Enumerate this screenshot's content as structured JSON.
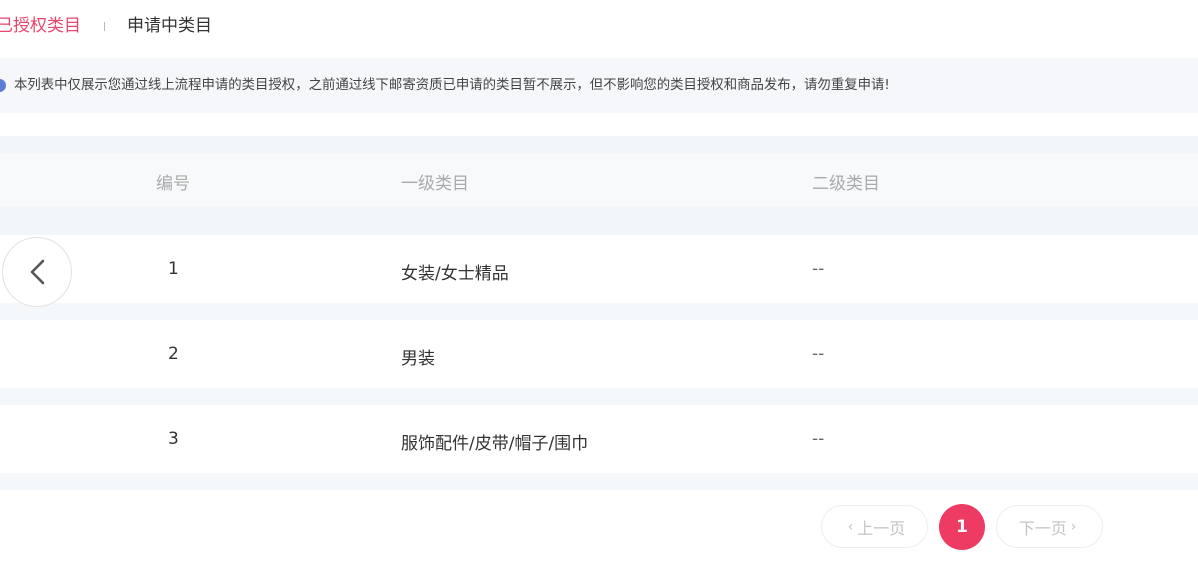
{
  "tabs": {
    "authorized": "已授权类目",
    "applying": "申请中类目"
  },
  "notice": {
    "text": "本列表中仅展示您通过线上流程申请的类目授权，之前通过线下邮寄资质已申请的类目暂不展示，但不影响您的类目授权和商品发布，请勿重复申请!"
  },
  "table": {
    "headers": {
      "num": "编号",
      "level1": "一级类目",
      "level2": "二级类目"
    },
    "rows": [
      {
        "num": "1",
        "level1": "女装/女士精品",
        "level2": "--"
      },
      {
        "num": "2",
        "level1": "男装",
        "level2": "--"
      },
      {
        "num": "3",
        "level1": "服饰配件/皮带/帽子/围巾",
        "level2": "--"
      }
    ]
  },
  "pagination": {
    "prev": "上一页",
    "current": "1",
    "next": "下一页"
  },
  "icons": {
    "back": "chevron-left-icon",
    "info": "info-icon",
    "prev_chevron": "chevron-left-small-icon",
    "next_chevron": "chevron-right-small-icon"
  },
  "colors": {
    "accent": "#e5466b",
    "page_active_bg": "#ee3b63",
    "notice_bg": "#f5f7fa",
    "info_icon": "#5b7fd6"
  }
}
